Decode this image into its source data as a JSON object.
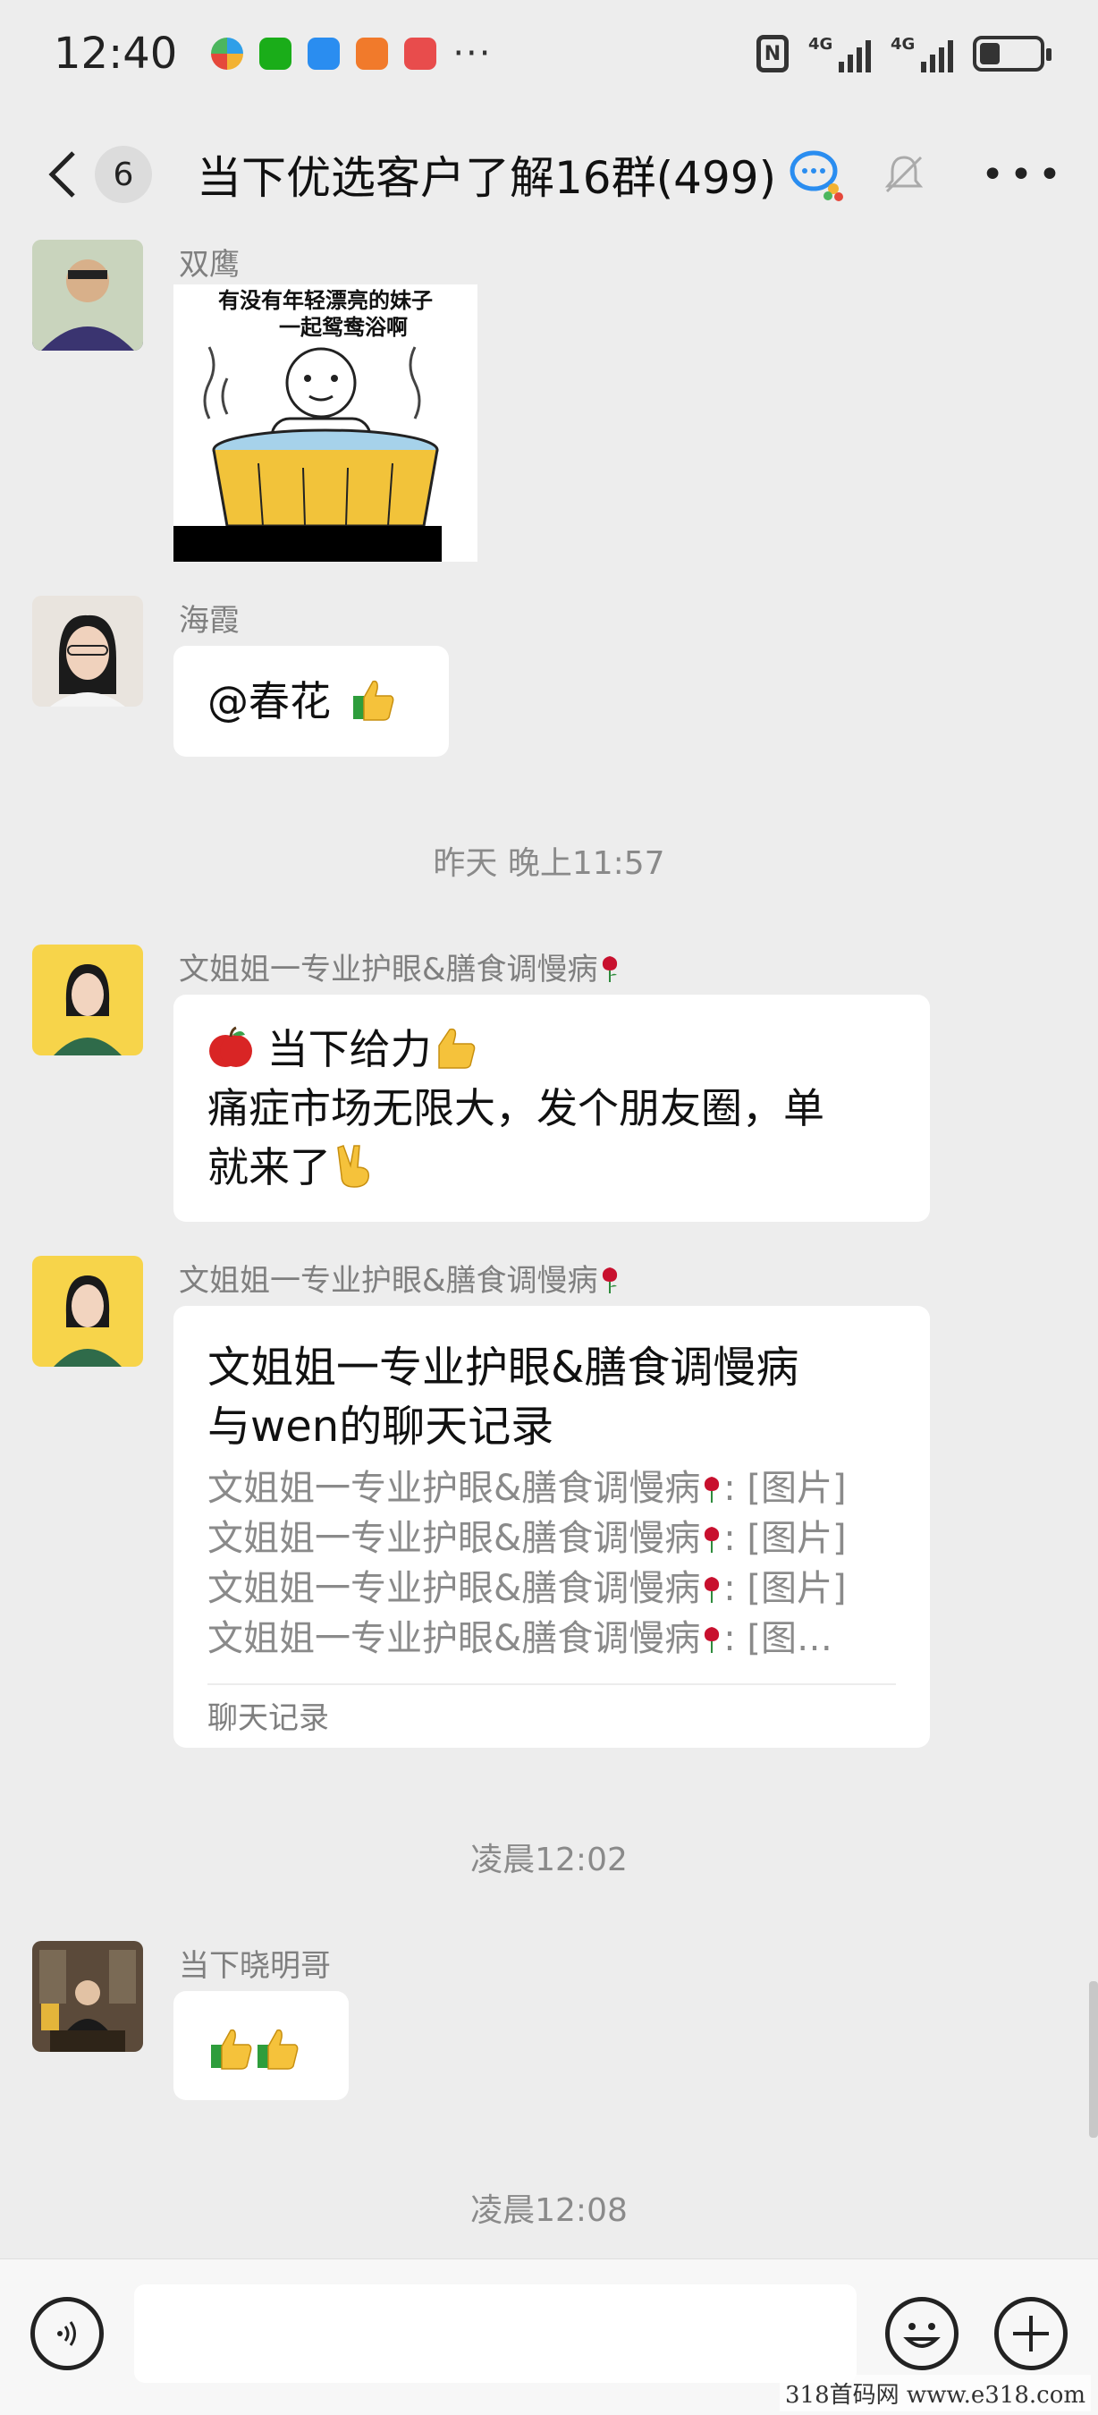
{
  "status_bar": {
    "time": "12:40",
    "more": "···",
    "nfc": "N",
    "network_1": "4G",
    "network_2": "4G"
  },
  "header": {
    "unread_count": "6",
    "title": "当下优选客户了解16群(499)"
  },
  "messages": [
    {
      "sender": "双鹰",
      "sticker_text_line1": "有没有年轻漂亮的妹子",
      "sticker_text_line2": "一起鸳鸯浴啊"
    },
    {
      "sender": "海霞",
      "text": "@春花 "
    },
    {
      "timestamp": "昨天 晚上11:57"
    },
    {
      "sender": "文姐姐一专业护眼&膳食调慢病",
      "line1": " 当下给力",
      "line2": "痛症市场无限大，发个朋友圈，单",
      "line3": "就来了"
    },
    {
      "sender": "文姐姐一专业护眼&膳食调慢病",
      "card_title_line1": "文姐姐一专业护眼&膳食调慢病",
      "card_title_line2": "与wen的聊天记录",
      "card_lines": [
        "文姐姐一专业护眼&膳食调慢病",
        "文姐姐一专业护眼&膳食调慢病",
        "文姐姐一专业护眼&膳食调慢病",
        "文姐姐一专业护眼&膳食调慢病"
      ],
      "card_line_suffixes": [
        ": [图片]",
        ": [图片]",
        ": [图片]",
        ": [图…"
      ],
      "card_footer": "聊天记录"
    },
    {
      "timestamp": "凌晨12:02"
    },
    {
      "sender": "当下晓明哥"
    },
    {
      "timestamp": "凌晨12:08"
    }
  ],
  "watermark": "318首码网  www.e318.com",
  "colors": {
    "background": "#ededed",
    "bubble": "#ffffff",
    "muted_text": "#8a8a8a",
    "thumb_yellow": "#f5c23b",
    "thumb_green": "#2e9d3c",
    "rose_red": "#c8102e"
  }
}
